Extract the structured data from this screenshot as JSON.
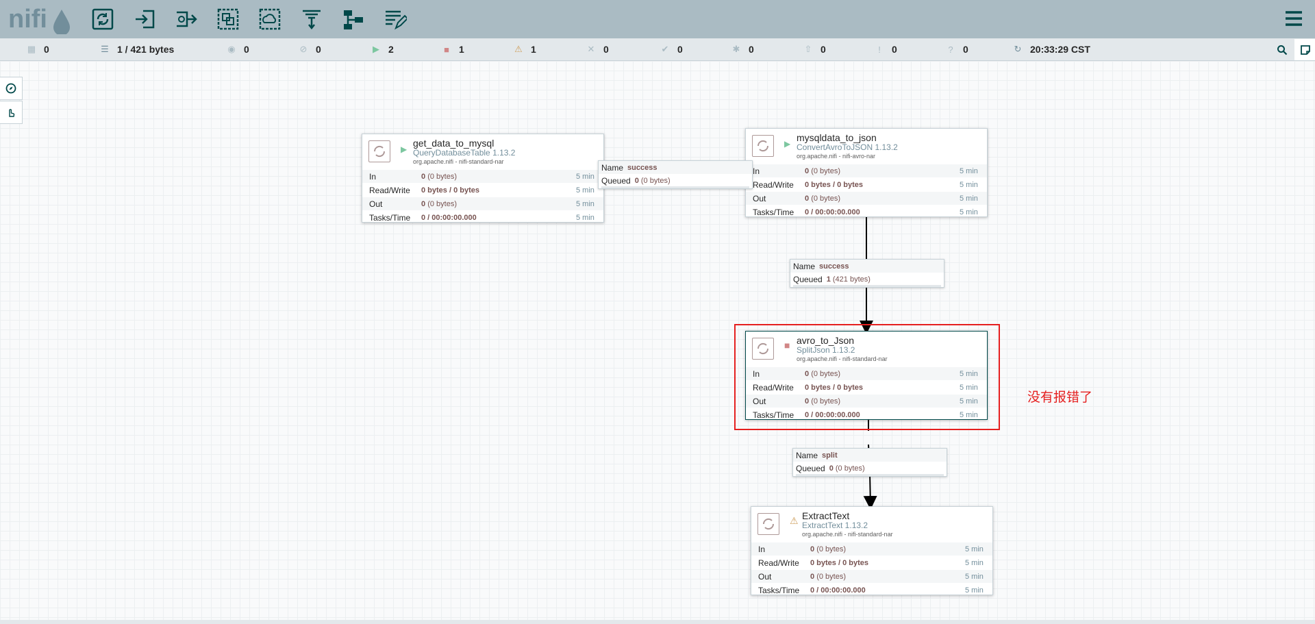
{
  "header": {
    "logo_text": "nifi",
    "toolbar": [
      {
        "icon": "processor-icon"
      },
      {
        "icon": "input-port-icon"
      },
      {
        "icon": "output-port-icon"
      },
      {
        "icon": "process-group-icon"
      },
      {
        "icon": "remote-process-group-icon"
      },
      {
        "icon": "funnel-icon"
      },
      {
        "icon": "template-icon"
      },
      {
        "icon": "label-icon"
      }
    ],
    "menu_icon": "hamburger-menu-icon"
  },
  "status": {
    "cluster": "0",
    "queued": "1 / 421 bytes",
    "transmitting": "0",
    "not_transmitting": "0",
    "running": "2",
    "stopped": "1",
    "invalid": "1",
    "disabled": "0",
    "up_to_date": "0",
    "locally_modified": "0",
    "stale": "0",
    "locally_modified_stale": "0",
    "sync_failure": "0",
    "refresh_time": "20:33:29 CST",
    "colors": {
      "running": "#7dc7a0",
      "stopped": "#d18686",
      "invalid": "#cf9f5d"
    }
  },
  "processors": [
    {
      "name": "get_data_to_mysql",
      "type": "QueryDatabaseTable 1.13.2",
      "bundle": "org.apache.nifi - nifi-standard-nar",
      "state": "running",
      "stats": [
        {
          "label": "In",
          "value": "0",
          "sub": "(0 bytes)",
          "time": "5 min"
        },
        {
          "label": "Read/Write",
          "value": "0 bytes / 0 bytes",
          "sub": "",
          "time": "5 min"
        },
        {
          "label": "Out",
          "value": "0",
          "sub": "(0 bytes)",
          "time": "5 min"
        },
        {
          "label": "Tasks/Time",
          "value": "0 / 00:00:00.000",
          "sub": "",
          "time": "5 min"
        }
      ]
    },
    {
      "name": "mysqldata_to_json",
      "type": "ConvertAvroToJSON 1.13.2",
      "bundle": "org.apache.nifi - nifi-avro-nar",
      "state": "running",
      "stats": [
        {
          "label": "In",
          "value": "0",
          "sub": "(0 bytes)",
          "time": "5 min"
        },
        {
          "label": "Read/Write",
          "value": "0 bytes / 0 bytes",
          "sub": "",
          "time": "5 min"
        },
        {
          "label": "Out",
          "value": "0",
          "sub": "(0 bytes)",
          "time": "5 min"
        },
        {
          "label": "Tasks/Time",
          "value": "0 / 00:00:00.000",
          "sub": "",
          "time": "5 min"
        }
      ]
    },
    {
      "name": "avro_to_Json",
      "type": "SplitJson 1.13.2",
      "bundle": "org.apache.nifi - nifi-standard-nar",
      "state": "stopped",
      "stats": [
        {
          "label": "In",
          "value": "0",
          "sub": "(0 bytes)",
          "time": "5 min"
        },
        {
          "label": "Read/Write",
          "value": "0 bytes / 0 bytes",
          "sub": "",
          "time": "5 min"
        },
        {
          "label": "Out",
          "value": "0",
          "sub": "(0 bytes)",
          "time": "5 min"
        },
        {
          "label": "Tasks/Time",
          "value": "0 / 00:00:00.000",
          "sub": "",
          "time": "5 min"
        }
      ]
    },
    {
      "name": "ExtractText",
      "type": "ExtractText 1.13.2",
      "bundle": "org.apache.nifi - nifi-standard-nar",
      "state": "invalid",
      "stats": [
        {
          "label": "In",
          "value": "0",
          "sub": "(0 bytes)",
          "time": "5 min"
        },
        {
          "label": "Read/Write",
          "value": "0 bytes / 0 bytes",
          "sub": "",
          "time": "5 min"
        },
        {
          "label": "Out",
          "value": "0",
          "sub": "(0 bytes)",
          "time": "5 min"
        },
        {
          "label": "Tasks/Time",
          "value": "0 / 00:00:00.000",
          "sub": "",
          "time": "5 min"
        }
      ]
    }
  ],
  "connections": [
    {
      "name_label": "Name",
      "name": "success",
      "queued_label": "Queued",
      "queued": "0",
      "queued_sub": "(0 bytes)"
    },
    {
      "name_label": "Name",
      "name": "success",
      "queued_label": "Queued",
      "queued": "1",
      "queued_sub": "(421 bytes)"
    },
    {
      "name_label": "Name",
      "name": "split",
      "queued_label": "Queued",
      "queued": "0",
      "queued_sub": "(0 bytes)"
    }
  ],
  "annotation": {
    "text": "没有报错了",
    "color": "#e51f1f"
  }
}
